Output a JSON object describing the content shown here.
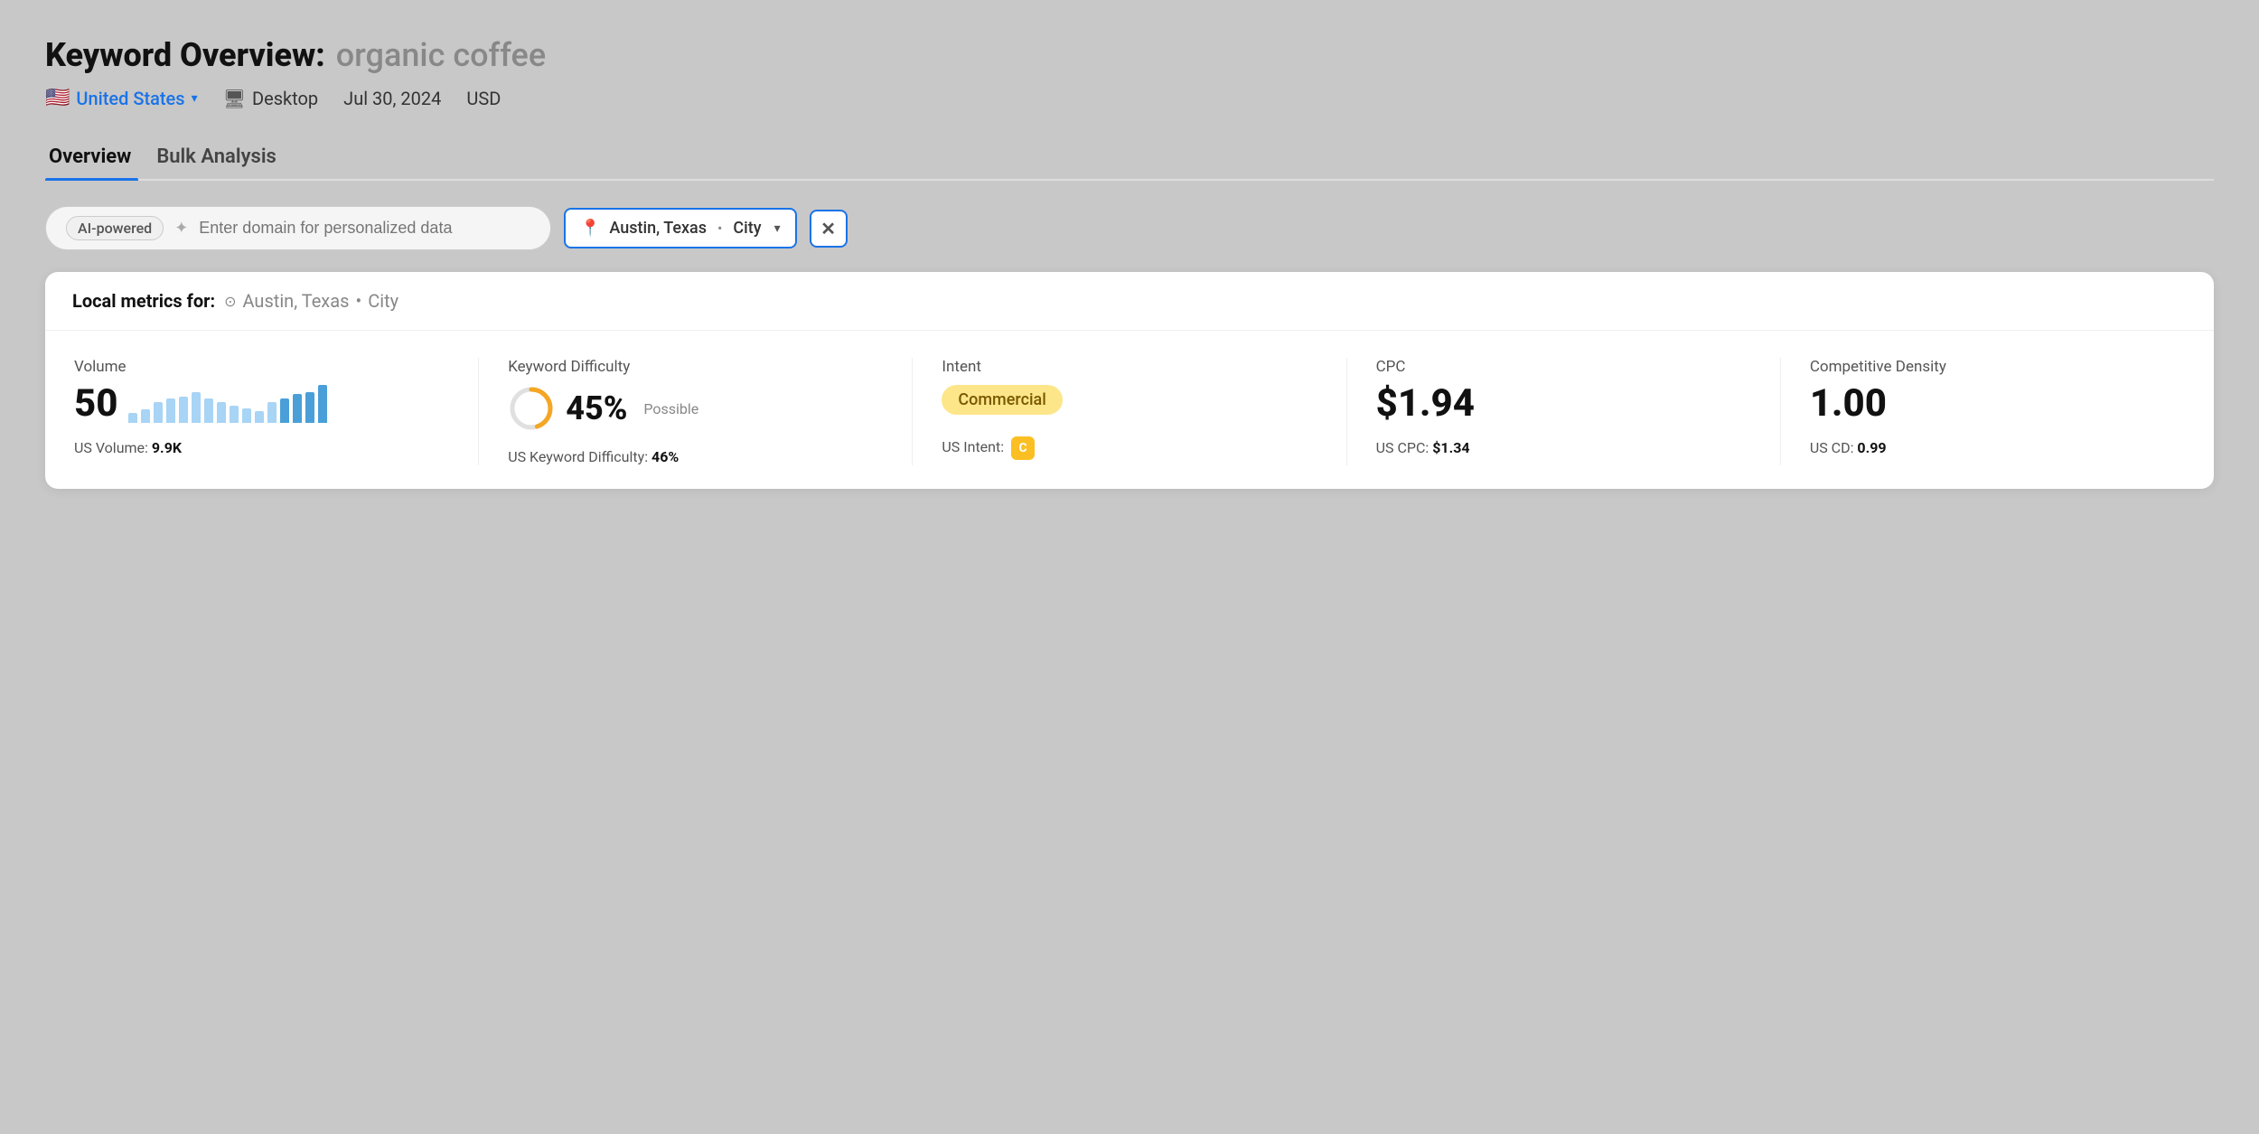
{
  "header": {
    "title_prefix": "Keyword Overview:",
    "title_keyword": "organic coffee",
    "country": "United States",
    "country_flag": "🇺🇸",
    "device": "Desktop",
    "date": "Jul 30, 2024",
    "currency": "USD"
  },
  "tabs": [
    {
      "label": "Overview",
      "active": true
    },
    {
      "label": "Bulk Analysis",
      "active": false
    }
  ],
  "search": {
    "ai_badge": "AI-powered",
    "placeholder": "Enter domain for personalized data",
    "location_city": "Austin, Texas",
    "location_sep": "•",
    "location_type": "City"
  },
  "metrics_card": {
    "header_label": "Local metrics for:",
    "header_pin": "📍",
    "header_location": "Austin, Texas",
    "header_sep": "•",
    "header_type": "City",
    "metrics": [
      {
        "label": "Volume",
        "main_value": "50",
        "sub_label": "US Volume:",
        "sub_value": "9.9K",
        "type": "volume"
      },
      {
        "label": "Keyword Difficulty",
        "main_value": "45%",
        "kd_note": "Possible",
        "kd_percent": 45,
        "sub_label": "US Keyword Difficulty:",
        "sub_value": "46%",
        "type": "kd"
      },
      {
        "label": "Intent",
        "main_value": "Commercial",
        "sub_label": "US Intent:",
        "sub_value": "C",
        "type": "intent"
      },
      {
        "label": "CPC",
        "main_value": "$1.94",
        "sub_label": "US CPC:",
        "sub_value": "$1.34",
        "type": "cpc"
      },
      {
        "label": "Competitive Density",
        "main_value": "1.00",
        "sub_label": "US CD:",
        "sub_value": "0.99",
        "type": "cd"
      }
    ]
  },
  "bar_data": [
    25,
    35,
    55,
    65,
    70,
    80,
    65,
    55,
    45,
    38,
    30,
    55,
    65,
    75,
    80,
    100
  ]
}
